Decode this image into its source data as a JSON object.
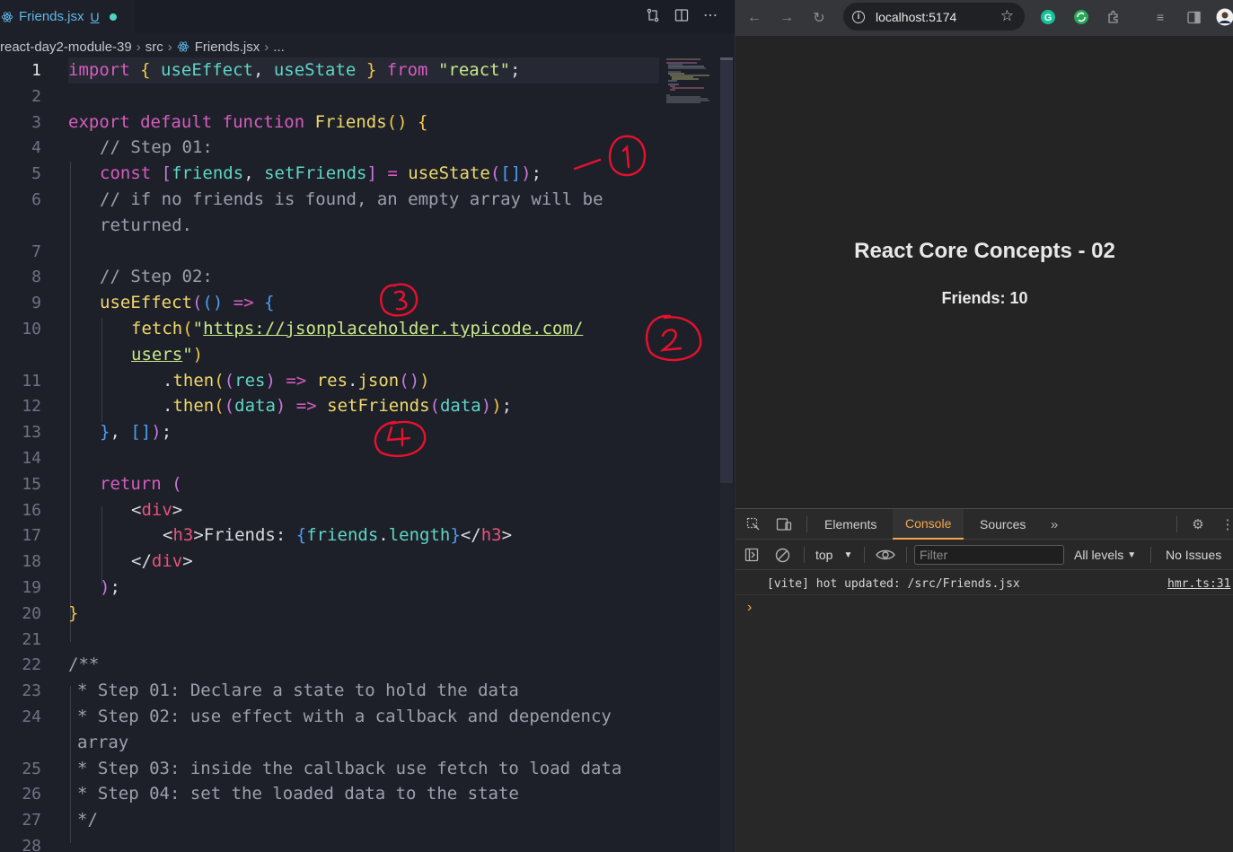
{
  "editor": {
    "tab": {
      "filename": "Friends.jsx",
      "status": "U"
    },
    "breadcrumb": [
      "react-day2-module-39",
      "src",
      "Friends.jsx",
      "..."
    ],
    "line_numbers": [
      "1",
      "2",
      "3",
      "4",
      "5",
      "6",
      "7",
      "8",
      "9",
      "10",
      "11",
      "12",
      "13",
      "14",
      "15",
      "16",
      "17",
      "18",
      "19",
      "20",
      "21",
      "22",
      "23",
      "24",
      "25",
      "26",
      "27",
      "28"
    ],
    "code": {
      "l1": {
        "import": "import",
        "open": "{",
        "useEffect": "useEffect",
        "comma": ",",
        "useState": "useState",
        "close": "}",
        "from": "from",
        "module": "\"react\"",
        "semi": ";"
      },
      "l3": {
        "export": "export",
        "default": "default",
        "function": "function",
        "name": "Friends",
        "parens": "()",
        "brace": "{"
      },
      "l4": "// Step 01:",
      "l5": {
        "const": "const",
        "lb": "[",
        "friends": "friends",
        "comma": ",",
        "setFriends": "setFriends",
        "rb": "]",
        "eq": "=",
        "useState": "useState",
        "open": "(",
        "arr": "[]",
        "close": ")",
        "semi": ";"
      },
      "l6a": "// if no friends is found, an empty array will be",
      "l6b": "returned.",
      "l8": "// Step 02:",
      "l9": {
        "useEffect": "useEffect",
        "open": "(",
        "parens": "()",
        "arrow": "=>",
        "brace": "{"
      },
      "l10a": {
        "fetch": "fetch",
        "open": "(",
        "quote": "\"",
        "url": "https://jsonplaceholder.typicode.com/"
      },
      "l10b": {
        "url": "users",
        "quote": "\"",
        "close": ")"
      },
      "l11": {
        "dot": ".",
        "then": "then",
        "open": "(",
        "param_open": "(",
        "res": "res",
        "param_close": ")",
        "arrow": "=>",
        "res2": "res",
        "dot2": ".",
        "json": "json",
        "call": "()",
        "close": ")"
      },
      "l12": {
        "dot": ".",
        "then": "then",
        "open": "(",
        "param_open": "(",
        "data": "data",
        "param_close": ")",
        "arrow": "=>",
        "setFriends": "setFriends",
        "call_open": "(",
        "data2": "data",
        "call_close": ")",
        "close": ")",
        "semi": ";"
      },
      "l13": {
        "brace": "}",
        "comma": ",",
        "arr_open": "[",
        "arr_close": "]",
        "close": ")",
        "semi": ";"
      },
      "l15": {
        "return": "return",
        "open": "("
      },
      "l16": {
        "lt": "<",
        "tag": "div",
        "gt": ">"
      },
      "l17": {
        "lt": "<",
        "tag": "h3",
        "gt": ">",
        "text": "Friends: ",
        "expr_open": "{",
        "friends": "friends",
        "dot": ".",
        "length": "length",
        "expr_close": "}",
        "close_lt": "</",
        "close_tag": "h3",
        "close_gt": ">"
      },
      "l18": {
        "lt": "</",
        "tag": "div",
        "gt": ">"
      },
      "l19": {
        "close": ")",
        "semi": ";"
      },
      "l20": "}",
      "l22": "/**",
      "l23": "* Step 01: Declare a state to hold the data",
      "l24a": "* Step 02: use effect with a callback and dependency",
      "l24b": "array",
      "l25": "* Step 03: inside the callback use fetch to load data",
      "l26": "* Step 04: set the loaded data to the state",
      "l27": "*/"
    }
  },
  "browser": {
    "url": "localhost:5174",
    "page": {
      "heading": "React Core Concepts - 02",
      "friends_count": "Friends: 10"
    },
    "devtools": {
      "tabs": [
        "Elements",
        "Console",
        "Sources"
      ],
      "active_tab": "Console",
      "context": "top",
      "filter_placeholder": "Filter",
      "levels": "All levels",
      "issues": "No Issues",
      "log_message": "[vite] hot updated: /src/Friends.jsx",
      "log_source": "hmr.ts:31",
      "prompt": "›"
    }
  },
  "colors": {
    "keyword": "#d65dbf",
    "function": "#f0d96b",
    "string": "#c8e88a",
    "console_accent": "#f3a74b",
    "annotation": "#e8112d"
  }
}
